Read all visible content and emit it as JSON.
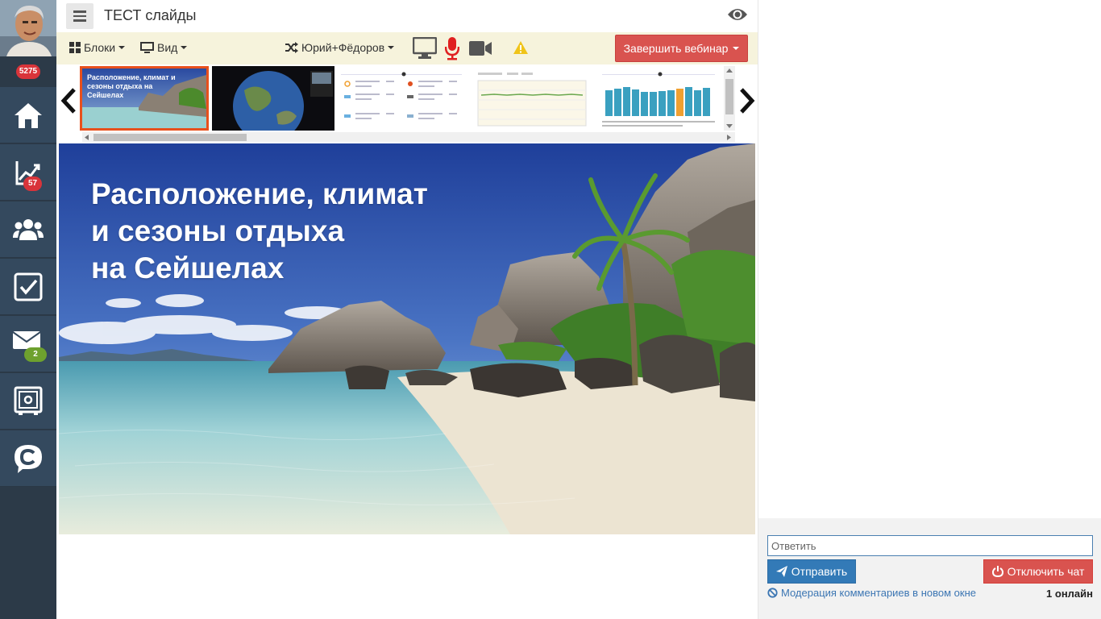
{
  "sidebar": {
    "avatar_badge": "5275",
    "items": [
      {
        "icon": "home-icon",
        "badge": ""
      },
      {
        "icon": "chart-icon",
        "badge": "57",
        "badge_color": "#d9343a"
      },
      {
        "icon": "users-icon",
        "badge": ""
      },
      {
        "icon": "checkbox-icon",
        "badge": ""
      },
      {
        "icon": "mail-icon",
        "badge": "2",
        "badge_color": "#6ea12e"
      },
      {
        "icon": "safe-icon",
        "badge": ""
      },
      {
        "icon": "chat-c-icon",
        "badge": ""
      }
    ]
  },
  "header": {
    "title": "ТЕСТ слайды"
  },
  "toolbar": {
    "blocks_label": "Блоки",
    "view_label": "Вид",
    "presenter_label": "Юрий+Фёдоров",
    "end_webinar_label": "Завершить вебинар"
  },
  "thumbnails": {
    "first_title": "Расположение, климат и сезоны отдыха на Сейшелах"
  },
  "slide": {
    "title_line1": "Расположение, климат",
    "title_line2": "и сезоны отдыха",
    "title_line3": "на Сейшелах"
  },
  "chat": {
    "reply_placeholder": "Ответить",
    "send_label": "Отправить",
    "disable_label": "Отключить чат",
    "moderation_label": "Модерация комментариев в новом окне",
    "online_label": "1 онлайн"
  },
  "colors": {
    "sidebar_bg": "#2c3a48",
    "accent_red": "#d9534f",
    "accent_blue": "#337ab7",
    "toolbar_bg": "#f6f3dc",
    "active_thumb": "#e8501c"
  }
}
